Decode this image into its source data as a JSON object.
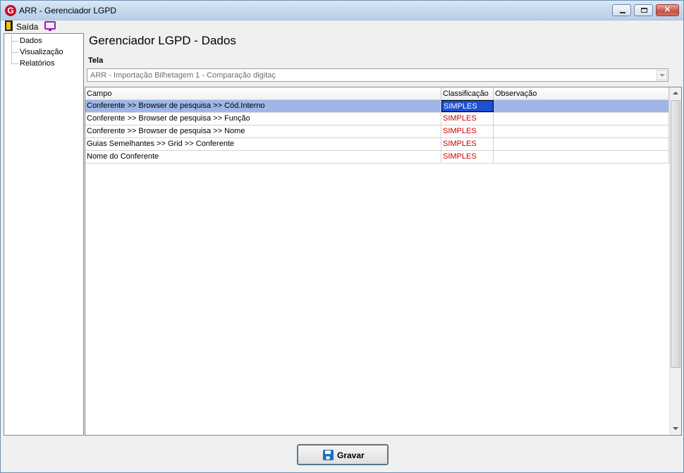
{
  "window": {
    "title": "ARR - Gerenciador LGPD",
    "app_icon_letter": "G",
    "controls": {
      "minimize": "",
      "maximize": "",
      "close": "✕"
    }
  },
  "menu": {
    "exit_label": "Saída"
  },
  "tree": {
    "items": [
      {
        "label": "Dados"
      },
      {
        "label": "Visualização"
      },
      {
        "label": "Relatórios"
      }
    ]
  },
  "main": {
    "title": "Gerenciador LGPD - Dados",
    "tela_label": "Tela",
    "tela_value": "ARR - Importação Bilhetagem 1 - Comparação digitaç"
  },
  "grid": {
    "columns": [
      "Campo",
      "Classificação",
      "Observação"
    ],
    "rows": [
      {
        "campo": "Conferente >> Browser de pesquisa >> Cód.Interno",
        "classificacao": "SIMPLES",
        "observacao": ""
      },
      {
        "campo": "Conferente >> Browser de pesquisa >> Função",
        "classificacao": "SIMPLES",
        "observacao": ""
      },
      {
        "campo": "Conferente >> Browser de pesquisa >> Nome",
        "classificacao": "SIMPLES",
        "observacao": ""
      },
      {
        "campo": "Guias Semelhantes >> Grid >> Conferente",
        "classificacao": "SIMPLES",
        "observacao": ""
      },
      {
        "campo": "Nome do Conferente",
        "classificacao": "SIMPLES",
        "observacao": ""
      }
    ]
  },
  "footer": {
    "save_label": "Gravar"
  },
  "colors": {
    "selected_row": "#9fb6e6",
    "selected_cell": "#1d4fd1",
    "classification_text": "#d00000"
  }
}
